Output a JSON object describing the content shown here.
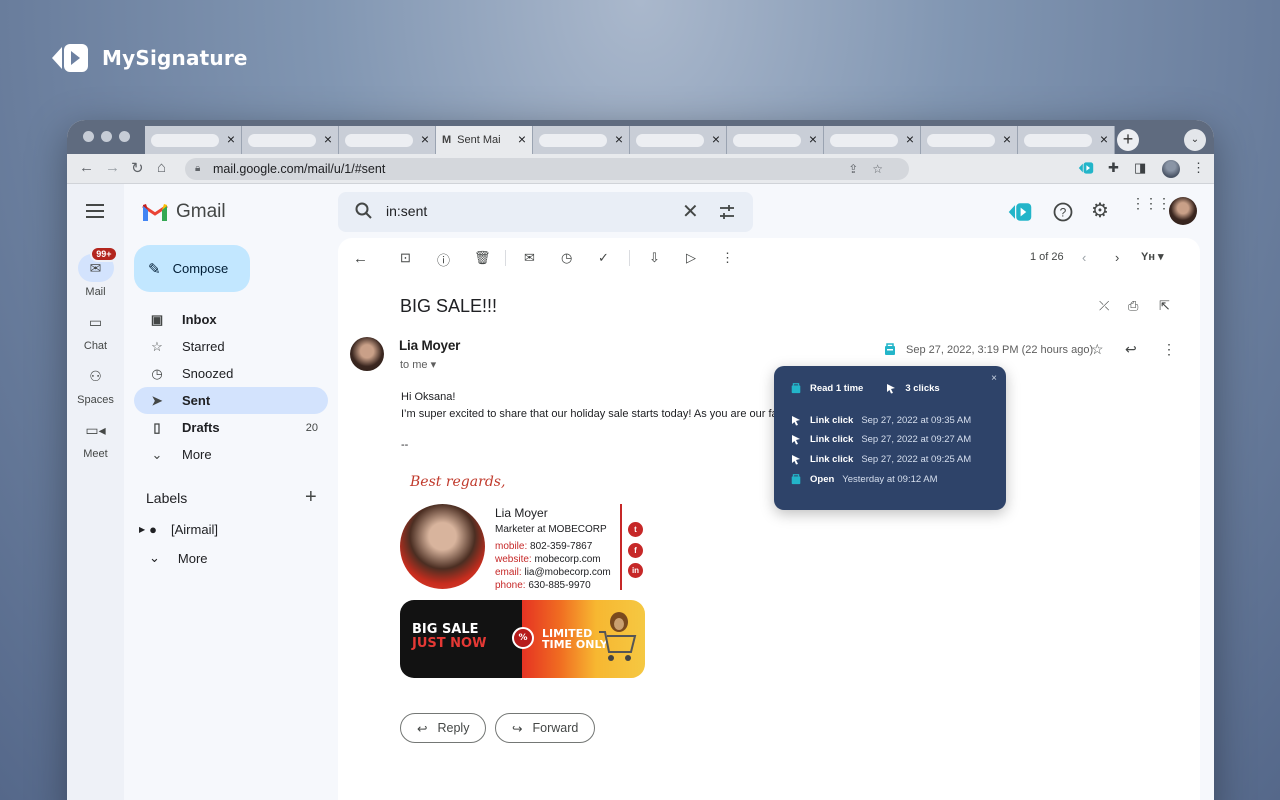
{
  "brand": {
    "name": "MySignature"
  },
  "browser": {
    "active_tab_title": "Sent Mai",
    "active_tab_favicon": "M",
    "url": "mail.google.com/mail/u/1/#sent",
    "tab_close": "×",
    "new_tab": "+",
    "tab_menu": "⌄"
  },
  "gmail": {
    "product": "Gmail",
    "search_query": "in:sent",
    "rail": [
      {
        "label": "Mail",
        "icon": "mail-icon",
        "badge": "99+"
      },
      {
        "label": "Chat",
        "icon": "chat-icon"
      },
      {
        "label": "Spaces",
        "icon": "spaces-icon"
      },
      {
        "label": "Meet",
        "icon": "meet-icon"
      }
    ],
    "compose_label": "Compose",
    "folders": [
      {
        "label": "Inbox",
        "icon": "inbox-icon",
        "count": ""
      },
      {
        "label": "Starred",
        "icon": "star-icon",
        "count": ""
      },
      {
        "label": "Snoozed",
        "icon": "clock-icon",
        "count": ""
      },
      {
        "label": "Sent",
        "icon": "send-icon",
        "count": ""
      },
      {
        "label": "Drafts",
        "icon": "draft-icon",
        "count": "20"
      },
      {
        "label": "More",
        "icon": "chevron-down-icon",
        "count": ""
      }
    ],
    "labels_heading": "Labels",
    "labels": [
      {
        "label": "[Airmail]"
      },
      {
        "label": "More"
      }
    ]
  },
  "message": {
    "pager": "1 of 26",
    "subject": "BIG SALE!!!",
    "sender": "Lia Moyer",
    "to": "to me",
    "date": "Sep 27, 2022, 3:19 PM (22 hours ago)",
    "greeting": "Hi Oksana!",
    "body": "I’m super excited to share that our holiday sale starts today! As you are our favor",
    "dashes": "--",
    "signature": {
      "sign_off": "Best regards,",
      "name": "Lia Moyer",
      "title": "Marketer at MOBECORP",
      "mobile_label": "mobile:",
      "mobile": "802-359-7867",
      "website_label": "website:",
      "website": "mobecorp.com",
      "email_label": "email:",
      "email": "lia@mobecorp.com",
      "phone_label": "phone:",
      "phone": "630-885-9970",
      "banner_left_1": "BIG SALE",
      "banner_left_2": "JUST NOW",
      "banner_right_1": "LIMITED",
      "banner_right_2": "TIME ONLY"
    },
    "reply_label": "Reply",
    "forward_label": "Forward"
  },
  "tracking_popup": {
    "read_label": "Read 1 time",
    "clicks_label": "3 clicks",
    "events": [
      {
        "type": "Link click",
        "time": "Sep 27, 2022 at 09:35 AM",
        "icon": "cursor-click-icon"
      },
      {
        "type": "Link click",
        "time": "Sep 27, 2022  at 09:27 AM",
        "icon": "cursor-click-icon"
      },
      {
        "type": "Link click",
        "time": "Sep 27, 2022 at 09:25 AM",
        "icon": "cursor-click-icon"
      },
      {
        "type": "Open",
        "time": "Yesterday at 09:12 AM",
        "icon": "envelope-open-icon"
      }
    ],
    "close": "×"
  },
  "colors": {
    "accent_teal": "#23b5c9",
    "compose_bg": "#c2e7ff",
    "active_folder": "#d3e3fd",
    "popup_bg": "#2e4369",
    "signature_red": "#c62828"
  }
}
